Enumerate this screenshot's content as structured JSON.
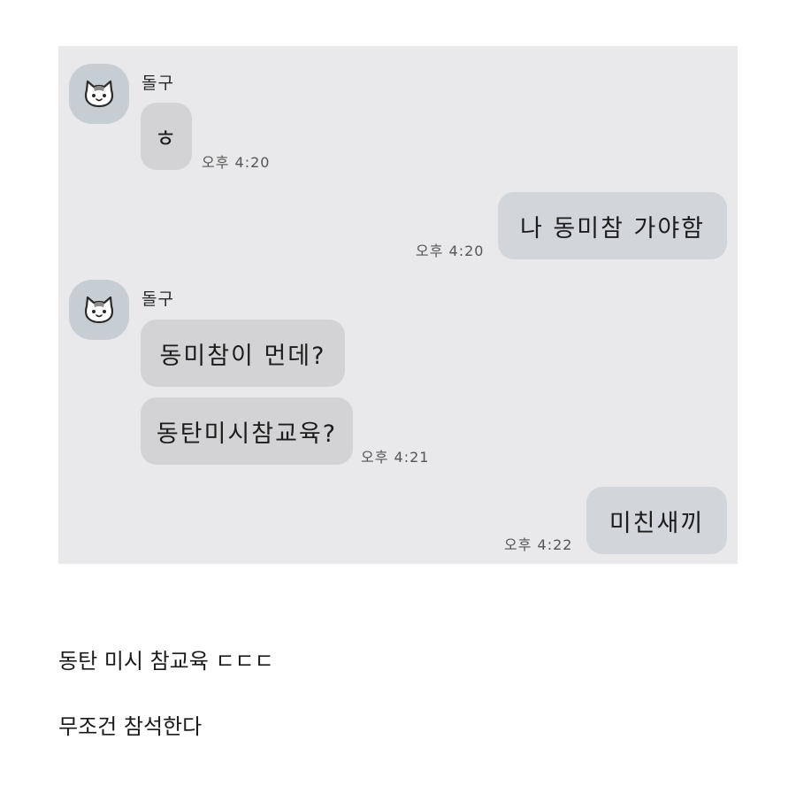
{
  "conversation": {
    "sender_name": "돌구",
    "avatar_icon": "cat-face-icon",
    "colors": {
      "background": "#e9e9eb",
      "incoming_bubble": "#d3d3d5",
      "outgoing_bubble": "#d2d6da",
      "avatar": "#c6cdd3"
    },
    "messages": [
      {
        "sender": "돌구",
        "direction": "incoming",
        "text": "ㅎ",
        "time": "오후 4:20"
      },
      {
        "sender": "me",
        "direction": "outgoing",
        "text": "나 동미참 가야함",
        "time": "오후 4:20"
      },
      {
        "sender": "돌구",
        "direction": "incoming",
        "text": "동미참이 먼데?",
        "time": ""
      },
      {
        "sender": "돌구",
        "direction": "incoming",
        "text": "동탄미시참교육?",
        "time": "오후 4:21"
      },
      {
        "sender": "me",
        "direction": "outgoing",
        "text": "미친새끼",
        "time": "오후 4:22"
      }
    ]
  },
  "captions": [
    "동탄 미시 참교육 ㄷㄷㄷ",
    "무조건 참석한다"
  ]
}
